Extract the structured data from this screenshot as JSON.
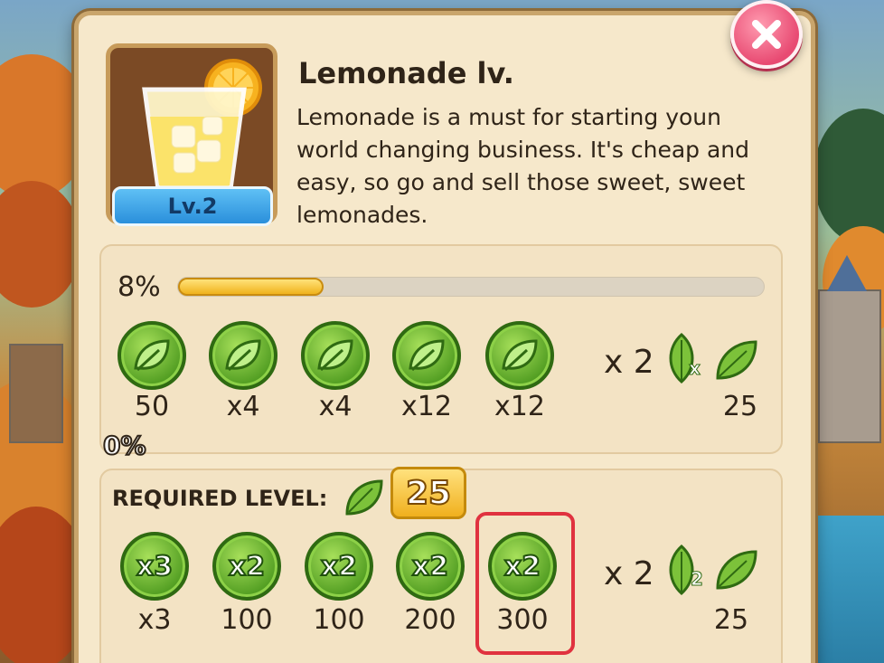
{
  "item": {
    "title": "Lemonade lv.",
    "description": "Lemonade is a must for starting youn world changing business. It's cheap and easy, so go and sell those sweet, sweet lemonades.",
    "level_badge": "Lv.2",
    "icon": "lemonade-glass-icon"
  },
  "progress": {
    "label": "8%",
    "value_percent": 8,
    "zero_label": "0%"
  },
  "tier1": {
    "coins": [
      {
        "icon": "leaf-coin-icon",
        "value": "50"
      },
      {
        "icon": "leaf-coin-icon",
        "value": "x4"
      },
      {
        "icon": "leaf-coin-icon",
        "value": "x4"
      },
      {
        "icon": "leaf-coin-icon",
        "value": "x12"
      },
      {
        "icon": "leaf-coin-icon",
        "value": "x12"
      }
    ],
    "multiplier": "x 2",
    "leaf_badge": "x",
    "reward_value": "25"
  },
  "requirement": {
    "label": "REQUIRED LEVEL:",
    "level": "25"
  },
  "tier2": {
    "coins": [
      {
        "mult": "x3",
        "value": "x3"
      },
      {
        "mult": "x2",
        "value": "100"
      },
      {
        "mult": "x2",
        "value": "100"
      },
      {
        "mult": "x2",
        "value": "200"
      },
      {
        "mult": "x2",
        "value": "300",
        "highlighted": true
      }
    ],
    "multiplier": "x 2",
    "leaf_badge": "2",
    "reward_value": "25"
  },
  "colors": {
    "parchment": "#f6e8cb",
    "coin_green": "#4d9a1f",
    "progress_gold": "#f0b21c",
    "close_pink": "#e84a72",
    "highlight_red": "#e0323f",
    "level_blue": "#2a8fdb"
  }
}
